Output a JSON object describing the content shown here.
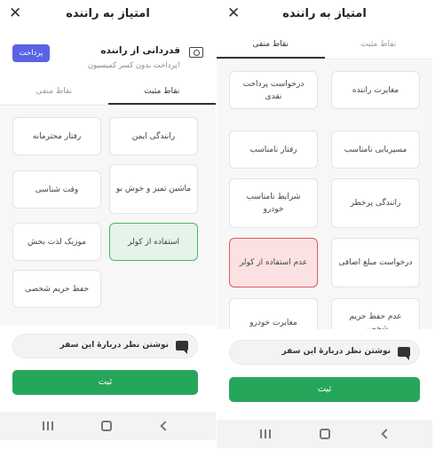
{
  "left": {
    "title": "امتیاز به راننده",
    "close": "✕",
    "tip": {
      "title": "قدردانی از راننده",
      "subtitle": "پرداخت بدون کسر کمیسیون!",
      "pay": "پرداخت"
    },
    "tabs": {
      "positive": "نقاط مثبت",
      "negative": "نقاط منفی"
    },
    "items": [
      "رانندگی ایمن",
      "رفتار محترمانه",
      "ماشین تمیز و خوش بو",
      "وقت شناسی",
      "استفاده از کولر",
      "موزیک لذت بخش",
      "حفظ حریم شخصی"
    ],
    "selected": "استفاده از کولر",
    "comment": "نوشتن نظر دربارهٔ این سفر",
    "submit": "ثبت"
  },
  "right": {
    "title": "امتیاز به راننده",
    "close": "✕",
    "tabs": {
      "positive": "نقاط مثبت",
      "negative": "نقاط منفی"
    },
    "items": [
      "مغایرت راننده",
      "درخواست پرداخت نقدی",
      "مسیریابی نامناسب",
      "رفتار نامناسب",
      "رانندگی پرخطر",
      "شرایط نامناسب خودرو",
      "درخواست مبلغ اضافی",
      "عدم استفاده از کولر",
      "عدم حفظ حریم شخصی",
      "مغایرت خودرو"
    ],
    "selected": "عدم استفاده از کولر",
    "comment": "نوشتن نظر دربارهٔ این سفر",
    "submit": "ثبت"
  },
  "colors": {
    "accent_green": "#26a65b",
    "pay_button": "#5a63e6",
    "selected_green_bg": "#e4f4e8",
    "selected_red_bg": "#fbe1e1"
  },
  "icons": {
    "close": "close-icon",
    "cash": "cash-icon",
    "message": "message-icon"
  }
}
